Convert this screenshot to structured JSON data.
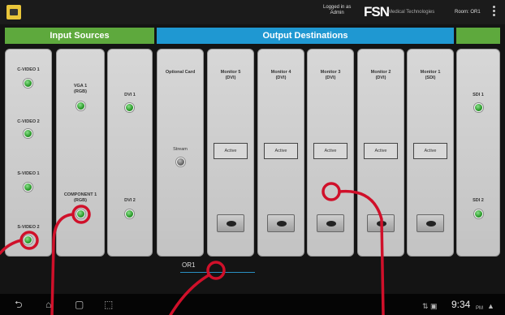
{
  "topbar": {
    "logged_in_line1": "Logged in as",
    "logged_in_line2": "Admin",
    "brand": "FSN",
    "brand_sub": "Medical Technologies",
    "room": "Room: OR1"
  },
  "tabs": {
    "input": "Input Sources",
    "output": "Output Destinations"
  },
  "inputs": {
    "col1": [
      "C-VIDEO 1",
      "C-VIDEO 2",
      "S-VIDEO 1",
      "S-VIDEO 2"
    ],
    "col2": [
      "VGA 1\n(RGB)",
      "COMPONENT 1\n(RGB)"
    ],
    "col3": [
      "DVI 1",
      "DVI 2"
    ]
  },
  "outputs": {
    "optional_card": "Optional Card",
    "stream": "Stream",
    "monitors": [
      {
        "label": "Monitor 5\n(DVI)",
        "status": "Active"
      },
      {
        "label": "Monitor 4\n(DVI)",
        "status": "Active"
      },
      {
        "label": "Monitor 3\n(DVI)",
        "status": "Active"
      },
      {
        "label": "Monitor 2\n(DVI)",
        "status": "Active"
      },
      {
        "label": "Monitor 1\n(SDI)",
        "status": "Active"
      }
    ],
    "sdi": [
      "SDI 1",
      "SDI 2"
    ]
  },
  "stream_field": {
    "value": "OR1"
  },
  "navbar": {
    "time": "9:34",
    "ampm": "PM"
  },
  "colors": {
    "input_tab": "#5ea93d",
    "output_tab": "#1f98d2",
    "annotation": "#d0102a"
  }
}
